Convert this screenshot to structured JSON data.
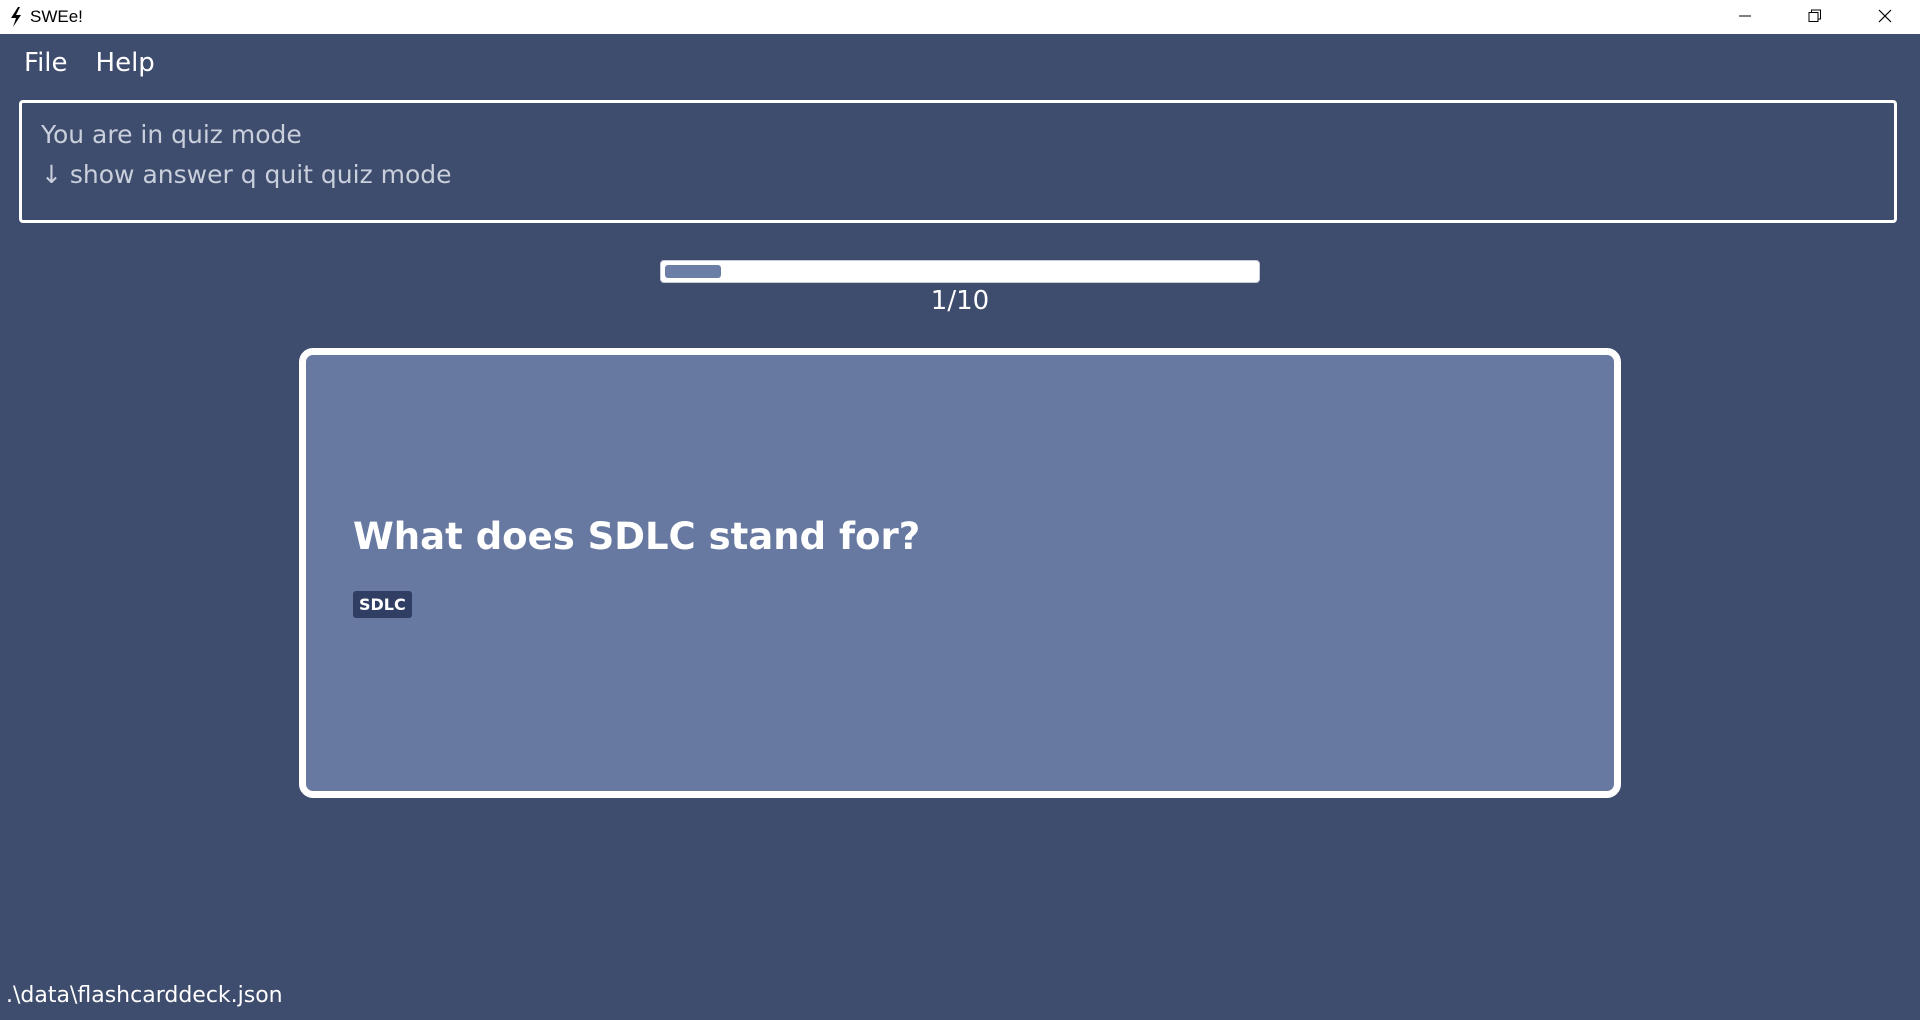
{
  "window": {
    "title": "SWEe!",
    "icon": "lightning-bolt-icon",
    "controls": [
      "minimize-icon",
      "restore-icon",
      "close-icon"
    ]
  },
  "menu": {
    "items": [
      {
        "label": "File"
      },
      {
        "label": "Help"
      }
    ]
  },
  "result": {
    "line1": "You are in quiz mode",
    "line2": "↓ show answer   q quit quiz mode"
  },
  "progress": {
    "current": 1,
    "total": 10,
    "fraction": 0.1,
    "label": "1/10"
  },
  "card": {
    "question": "What does SDLC stand for?",
    "tag": "SDLC"
  },
  "status": {
    "file_path": ".\\data\\flashcarddeck.json"
  },
  "colors": {
    "background": "#3e4c6e",
    "card": "#6779a1",
    "progress_fill": "#6b7fa6",
    "tag_bg": "#2f3e62"
  }
}
